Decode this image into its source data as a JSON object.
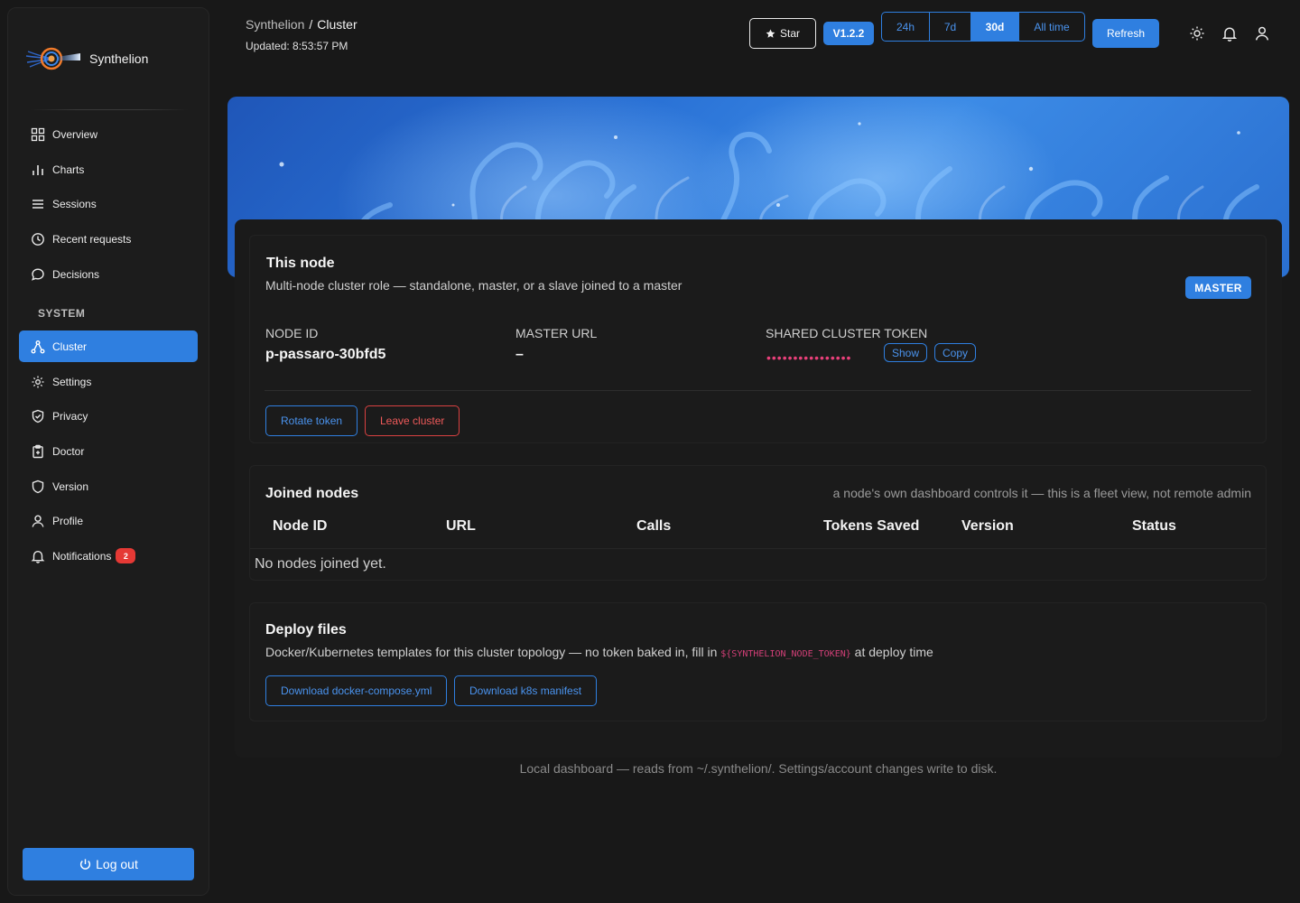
{
  "app": {
    "name": "Synthelion"
  },
  "breadcrumb": {
    "parent": "Synthelion",
    "separator": "/",
    "current": "Cluster"
  },
  "updated": "Updated: 8:53:57 PM",
  "toolbar": {
    "star_label": "Star",
    "version": "V1.2.2",
    "ranges": [
      "24h",
      "7d",
      "30d",
      "All time"
    ],
    "selected_range": "30d",
    "refresh_label": "Refresh"
  },
  "sidebar": {
    "items": [
      {
        "label": "Overview",
        "icon": "grid-icon"
      },
      {
        "label": "Charts",
        "icon": "bar-chart-icon"
      },
      {
        "label": "Sessions",
        "icon": "list-icon"
      },
      {
        "label": "Recent requests",
        "icon": "clock-icon"
      },
      {
        "label": "Decisions",
        "icon": "chat-bubble-icon"
      }
    ],
    "section_label": "SYSTEM",
    "system_items": [
      {
        "label": "Cluster",
        "icon": "nodes-icon",
        "active": true
      },
      {
        "label": "Settings",
        "icon": "gear-icon"
      },
      {
        "label": "Privacy",
        "icon": "shield-check-icon"
      },
      {
        "label": "Doctor",
        "icon": "clipboard-icon"
      },
      {
        "label": "Version",
        "icon": "shield-icon"
      },
      {
        "label": "Profile",
        "icon": "user-icon"
      },
      {
        "label": "Notifications",
        "icon": "bell-icon",
        "badge": "2"
      }
    ],
    "logout_label": "Log out"
  },
  "this_node": {
    "title": "This node",
    "subtitle": "Multi-node cluster role — standalone, master, or a slave joined to a master",
    "role_badge": "MASTER",
    "node_id_label": "NODE ID",
    "node_id": "p-passaro-30bfd5",
    "master_url_label": "MASTER URL",
    "master_url": "–",
    "token_label": "SHARED CLUSTER TOKEN",
    "token_masked": "••••••••••••••••",
    "show_label": "Show",
    "copy_label": "Copy",
    "rotate_label": "Rotate token",
    "leave_label": "Leave cluster"
  },
  "joined_nodes": {
    "title": "Joined nodes",
    "hint": "a node's own dashboard controls it — this is a fleet view, not remote admin",
    "columns": [
      "Node ID",
      "URL",
      "Calls",
      "Tokens Saved",
      "Version",
      "Status"
    ],
    "empty": "No nodes joined yet."
  },
  "deploy": {
    "title": "Deploy files",
    "desc_before": "Docker/Kubernetes templates for this cluster topology — no token baked in, fill in",
    "env_var": "${SYNTHELION_NODE_TOKEN}",
    "desc_after": "at deploy time",
    "compose_label": "Download docker-compose.yml",
    "k8s_label": "Download k8s manifest"
  },
  "footer": "Local dashboard — reads from ~/.synthelion/. Settings/account changes write to disk.",
  "colors": {
    "accent": "#2f7fe0",
    "danger": "#d94141",
    "token": "#e9407a",
    "background": "#181818"
  }
}
